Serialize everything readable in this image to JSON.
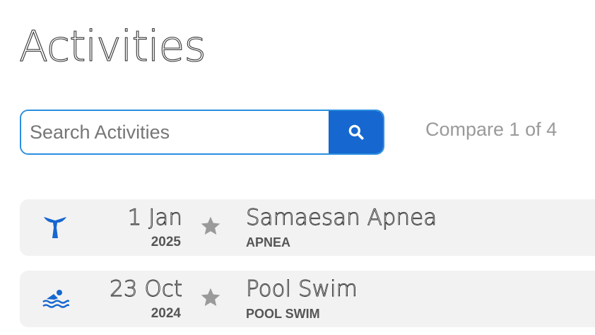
{
  "header": {
    "title": "Activities"
  },
  "search": {
    "placeholder": "Search Activities"
  },
  "compare": {
    "text": "Compare 1 of 4"
  },
  "colors": {
    "accent": "#1667d0",
    "search_border": "#2a8fe0",
    "row_bg": "#f2f2f2",
    "star": "#9a9a9a"
  },
  "activities": [
    {
      "day": "1 Jan",
      "year": "2025",
      "name": "Samaesan Apnea",
      "type": "APNEA",
      "icon": "whale-tail-icon"
    },
    {
      "day": "23 Oct",
      "year": "2024",
      "name": "Pool Swim",
      "type": "POOL SWIM",
      "icon": "swimmer-icon"
    }
  ]
}
